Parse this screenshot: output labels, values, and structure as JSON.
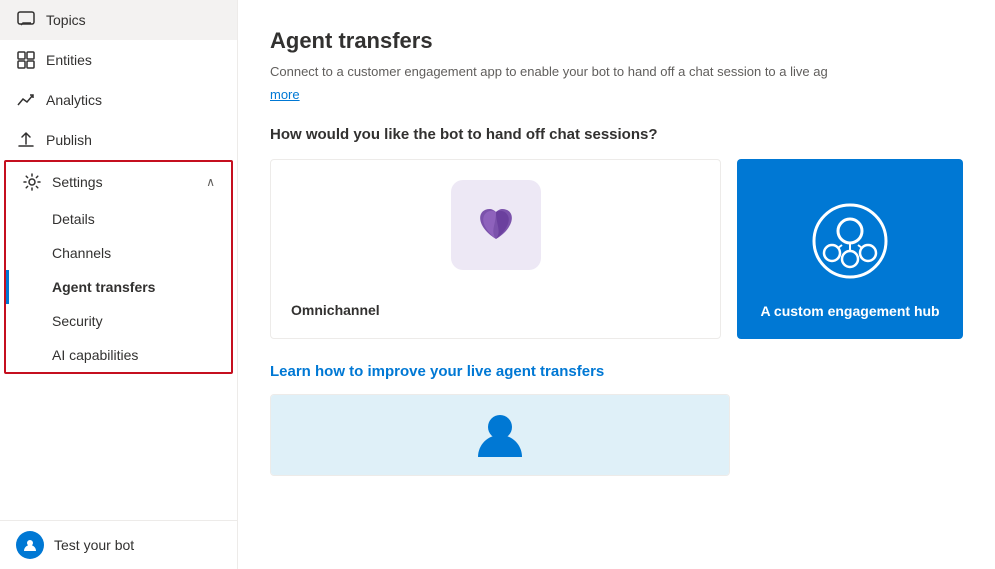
{
  "sidebar": {
    "items": [
      {
        "id": "topics",
        "label": "Topics",
        "icon": "chat-icon"
      },
      {
        "id": "entities",
        "label": "Entities",
        "icon": "grid-icon"
      },
      {
        "id": "analytics",
        "label": "Analytics",
        "icon": "analytics-icon"
      },
      {
        "id": "publish",
        "label": "Publish",
        "icon": "publish-icon"
      },
      {
        "id": "settings",
        "label": "Settings",
        "icon": "settings-icon"
      }
    ],
    "settings_sub": [
      {
        "id": "details",
        "label": "Details"
      },
      {
        "id": "channels",
        "label": "Channels"
      },
      {
        "id": "agent-transfers",
        "label": "Agent transfers",
        "active": true
      },
      {
        "id": "security",
        "label": "Security"
      },
      {
        "id": "ai-capabilities",
        "label": "AI capabilities"
      }
    ],
    "bottom": {
      "label": "Test your bot",
      "icon": "bot-icon"
    }
  },
  "main": {
    "title": "Agent transfers",
    "subtitle": "Connect to a customer engagement app to enable your bot to hand off a chat session to a live ag",
    "more_link": "more",
    "section1_title": "How would you like the bot to hand off chat sessions?",
    "card1_label": "Omnichannel",
    "card2_label": "A custom engagement hub",
    "section2_title": "Learn how to improve your live agent transfers",
    "learn_card_img_icon": "person-icon"
  }
}
